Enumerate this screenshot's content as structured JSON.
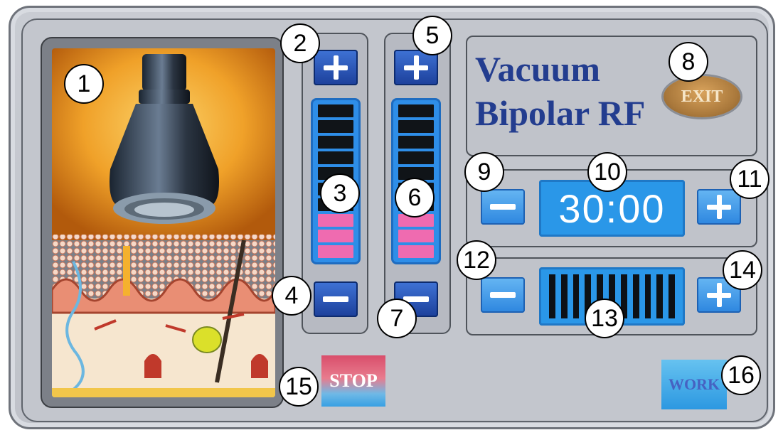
{
  "control_panel": {
    "title_line1": "Vacuum",
    "title_line2": "Bipolar RF",
    "exit_label": "EXIT",
    "timer_value": "30:00",
    "stop_label": "STOP",
    "work_label": "WORK"
  },
  "sliders": {
    "left": {
      "segments_total": 10,
      "segments_lit": 3,
      "lit_color": "#ef6bb0"
    },
    "right": {
      "segments_total": 10,
      "segments_lit": 3,
      "lit_color": "#ef6bb0"
    }
  },
  "level_bar": {
    "bars_total": 11
  },
  "colors": {
    "button_blue": "#1c3f9a",
    "display_blue": "#2a97e8",
    "title_blue": "#233d8f",
    "exit_gold": "#a9783b",
    "stop_red": "#d94e6b"
  },
  "callouts": [
    "1",
    "2",
    "3",
    "4",
    "5",
    "6",
    "7",
    "8",
    "9",
    "10",
    "11",
    "12",
    "13",
    "14",
    "15",
    "16"
  ],
  "icons": {
    "plus": "plus-icon",
    "minus": "minus-icon",
    "handpiece": "rf-handpiece-image"
  }
}
